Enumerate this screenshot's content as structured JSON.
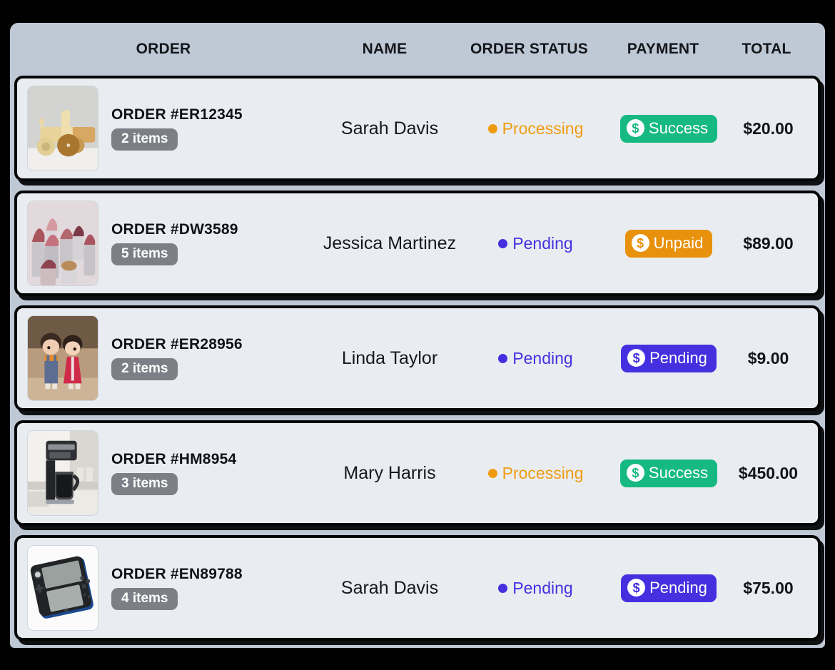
{
  "theme": {
    "page_background": "#000000",
    "panel_background": "#bfc9d6",
    "row_background": "#e9edf1",
    "row_border": "#050505",
    "items_badge_bg": "#7c7f85",
    "status_processing_color": "#ef9b11",
    "status_pending_color": "#4530e0",
    "payment_success_bg": "#16b981",
    "payment_unpaid_bg": "#e8910c",
    "payment_pending_bg": "#4530e0"
  },
  "table": {
    "columns": [
      {
        "key": "order",
        "label": "ORDER"
      },
      {
        "key": "name",
        "label": "NAME"
      },
      {
        "key": "status",
        "label": "ORDER STATUS"
      },
      {
        "key": "payment",
        "label": "PAYMENT"
      },
      {
        "key": "total",
        "label": "TOTAL"
      }
    ],
    "rows": [
      {
        "order_id": "ORDER #ER12345",
        "items": "2 items",
        "thumbnail": "wooden-toy-car-image",
        "name": "Sarah Davis",
        "status": {
          "label": "Processing",
          "color": "#ef9b11"
        },
        "payment": {
          "label": "Success",
          "icon": "dollar-circle-icon",
          "bg": "#16b981",
          "icon_color": "#16b981"
        },
        "total": "$20.00"
      },
      {
        "order_id": "ORDER #DW3589",
        "items": "5 items",
        "thumbnail": "lipsticks-image",
        "name": "Jessica Martinez",
        "status": {
          "label": "Pending",
          "color": "#4530e0"
        },
        "payment": {
          "label": "Unpaid",
          "icon": "dollar-circle-icon",
          "bg": "#e8910c",
          "icon_color": "#e8910c"
        },
        "total": "$89.00"
      },
      {
        "order_id": "ORDER #ER28956",
        "items": "2 items",
        "thumbnail": "doll-figurines-image",
        "name": "Linda Taylor",
        "status": {
          "label": "Pending",
          "color": "#4530e0"
        },
        "payment": {
          "label": "Pending",
          "icon": "dollar-circle-icon",
          "bg": "#4530e0",
          "icon_color": "#4530e0"
        },
        "total": "$9.00"
      },
      {
        "order_id": "ORDER #HM8954",
        "items": "3 items",
        "thumbnail": "coffee-maker-image",
        "name": "Mary Harris",
        "status": {
          "label": "Processing",
          "color": "#ef9b11"
        },
        "payment": {
          "label": "Success",
          "icon": "dollar-circle-icon",
          "bg": "#16b981",
          "icon_color": "#16b981"
        },
        "total": "$450.00"
      },
      {
        "order_id": "ORDER #EN89788",
        "items": "4 items",
        "thumbnail": "handheld-game-console-image",
        "name": "Sarah Davis",
        "status": {
          "label": "Pending",
          "color": "#4530e0"
        },
        "payment": {
          "label": "Pending",
          "icon": "dollar-circle-icon",
          "bg": "#4530e0",
          "icon_color": "#4530e0"
        },
        "total": "$75.00"
      }
    ]
  },
  "icons": {
    "dollar_glyph": "$"
  }
}
